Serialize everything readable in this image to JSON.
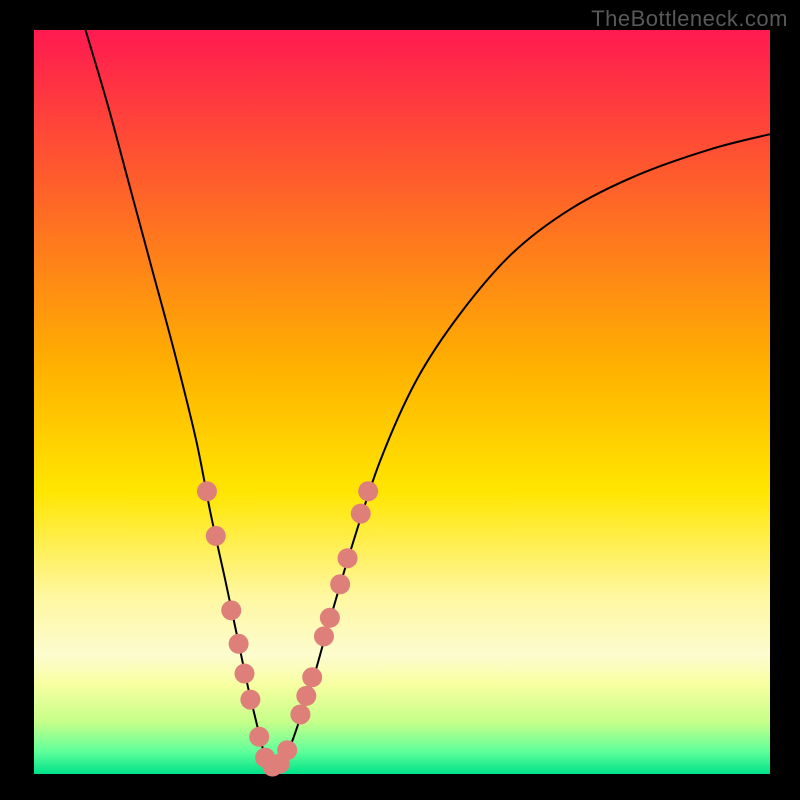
{
  "watermark": "TheBottleneck.com",
  "chart_data": {
    "type": "line",
    "title": "",
    "xlabel": "",
    "ylabel": "",
    "xlim": [
      0,
      100
    ],
    "ylim": [
      0,
      100
    ],
    "background_gradient": {
      "stops": [
        {
          "offset": 0.0,
          "color": "#ff1a50"
        },
        {
          "offset": 0.45,
          "color": "#ffb000"
        },
        {
          "offset": 0.62,
          "color": "#ffe600"
        },
        {
          "offset": 0.76,
          "color": "#fff7a0"
        },
        {
          "offset": 0.84,
          "color": "#fcfccf"
        },
        {
          "offset": 0.88,
          "color": "#f7ffa0"
        },
        {
          "offset": 0.93,
          "color": "#c6ff8a"
        },
        {
          "offset": 0.97,
          "color": "#5fff9a"
        },
        {
          "offset": 1.0,
          "color": "#00e28a"
        }
      ]
    },
    "series": [
      {
        "name": "bottleneck-curve",
        "color": "#000000",
        "x": [
          7,
          10,
          13,
          16,
          19,
          22,
          24,
          26,
          27.5,
          29,
          30.2,
          31.2,
          32,
          33,
          34.5,
          36,
          38,
          40,
          43,
          47,
          52,
          58,
          65,
          73,
          82,
          92,
          100
        ],
        "y": [
          100,
          90,
          79,
          68,
          57,
          45,
          35,
          26,
          19,
          12,
          7,
          3,
          0.8,
          0.8,
          3,
          7,
          13,
          20,
          30,
          42,
          53,
          62,
          70,
          76,
          80.5,
          84,
          86
        ]
      }
    ],
    "markers": {
      "name": "highlighted-points",
      "color": "#df7f7a",
      "radius_px": 10,
      "points": [
        {
          "x": 23.5,
          "y": 38
        },
        {
          "x": 24.7,
          "y": 32
        },
        {
          "x": 26.8,
          "y": 22
        },
        {
          "x": 27.8,
          "y": 17.5
        },
        {
          "x": 28.6,
          "y": 13.5
        },
        {
          "x": 29.4,
          "y": 10
        },
        {
          "x": 30.6,
          "y": 5
        },
        {
          "x": 31.4,
          "y": 2.2
        },
        {
          "x": 32.4,
          "y": 1.0
        },
        {
          "x": 33.4,
          "y": 1.4
        },
        {
          "x": 34.4,
          "y": 3.2
        },
        {
          "x": 36.2,
          "y": 8
        },
        {
          "x": 37.0,
          "y": 10.5
        },
        {
          "x": 37.8,
          "y": 13
        },
        {
          "x": 39.4,
          "y": 18.5
        },
        {
          "x": 40.2,
          "y": 21
        },
        {
          "x": 41.6,
          "y": 25.5
        },
        {
          "x": 42.6,
          "y": 29
        },
        {
          "x": 44.4,
          "y": 35
        },
        {
          "x": 45.4,
          "y": 38
        }
      ]
    }
  }
}
